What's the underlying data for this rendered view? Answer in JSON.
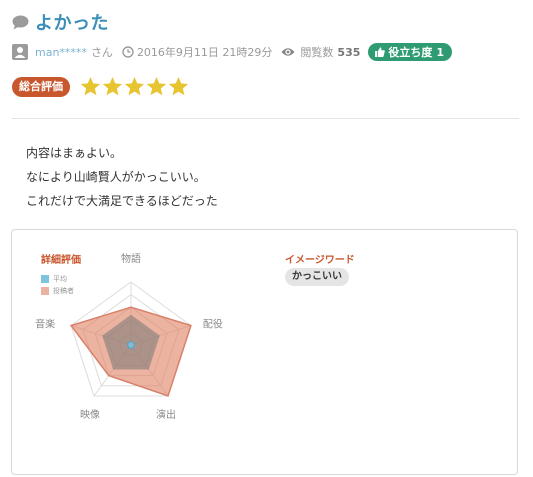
{
  "review": {
    "title": "よかった",
    "username": "man*****",
    "honorific": "さん",
    "date": "2016年9月11日 21時29分",
    "views_label": "閲覧数",
    "views_count": "535",
    "helpful_label": "役立ち度",
    "helpful_count": "1",
    "overall_label": "総合評価",
    "rating": 5,
    "rating_max": 5,
    "body_lines": [
      "内容はまぁよい。",
      "なにより山崎賢人がかっこいい。",
      "これだけで大満足できるほどだった"
    ]
  },
  "detail": {
    "title": "詳細評価",
    "legend": [
      {
        "label": "平均",
        "color": "#7fc4de"
      },
      {
        "label": "投稿者",
        "color": "#eab2a0"
      }
    ],
    "image_word_title": "イメージワード",
    "image_words": [
      "かっこいい"
    ]
  },
  "chart_data": {
    "type": "radar",
    "axes": [
      "物語",
      "配役",
      "演出",
      "映像",
      "音楽"
    ],
    "max": 5,
    "series": [
      {
        "name": "平均",
        "values": [
          0.3,
          0.3,
          0.3,
          0.3,
          0.3
        ]
      },
      {
        "name": "投稿者",
        "values": [
          3,
          5,
          5,
          3,
          5
        ]
      }
    ]
  },
  "colors": {
    "title": "#3a8eb7",
    "accent": "#c8572e",
    "helpful_badge": "#2f9b72",
    "star": "#e6c531",
    "link": "#7ab3cf"
  }
}
